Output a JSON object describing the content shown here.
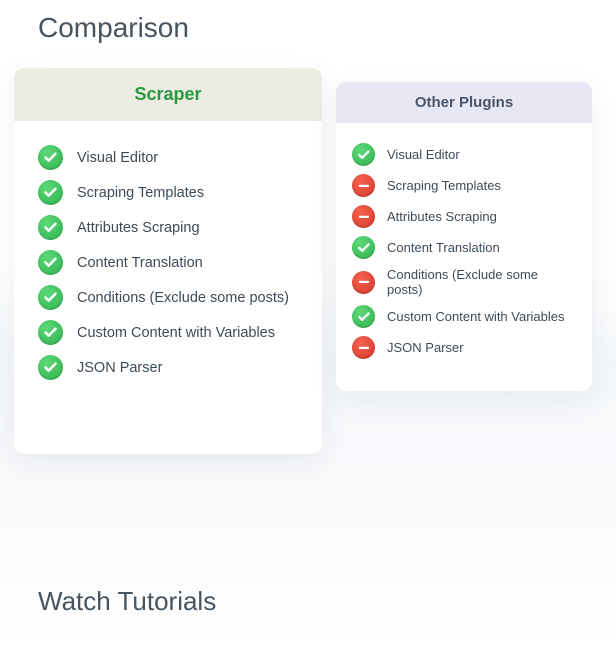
{
  "heading": "Comparison",
  "scraper": {
    "title": "Scraper",
    "items": [
      {
        "label": "Visual Editor",
        "ok": true
      },
      {
        "label": "Scraping Templates",
        "ok": true
      },
      {
        "label": "Attributes Scraping",
        "ok": true
      },
      {
        "label": "Content Translation",
        "ok": true
      },
      {
        "label": "Conditions (Exclude some posts)",
        "ok": true
      },
      {
        "label": "Custom Content with Variables",
        "ok": true
      },
      {
        "label": "JSON Parser",
        "ok": true
      }
    ]
  },
  "other": {
    "title": "Other Plugins",
    "items": [
      {
        "label": "Visual Editor",
        "ok": true
      },
      {
        "label": "Scraping Templates",
        "ok": false
      },
      {
        "label": "Attributes Scraping",
        "ok": false
      },
      {
        "label": "Content Translation",
        "ok": true
      },
      {
        "label": "Conditions (Exclude some posts)",
        "ok": false
      },
      {
        "label": "Custom Content with Variables",
        "ok": true
      },
      {
        "label": "JSON Parser",
        "ok": false
      }
    ]
  },
  "heading2": "Watch Tutorials"
}
